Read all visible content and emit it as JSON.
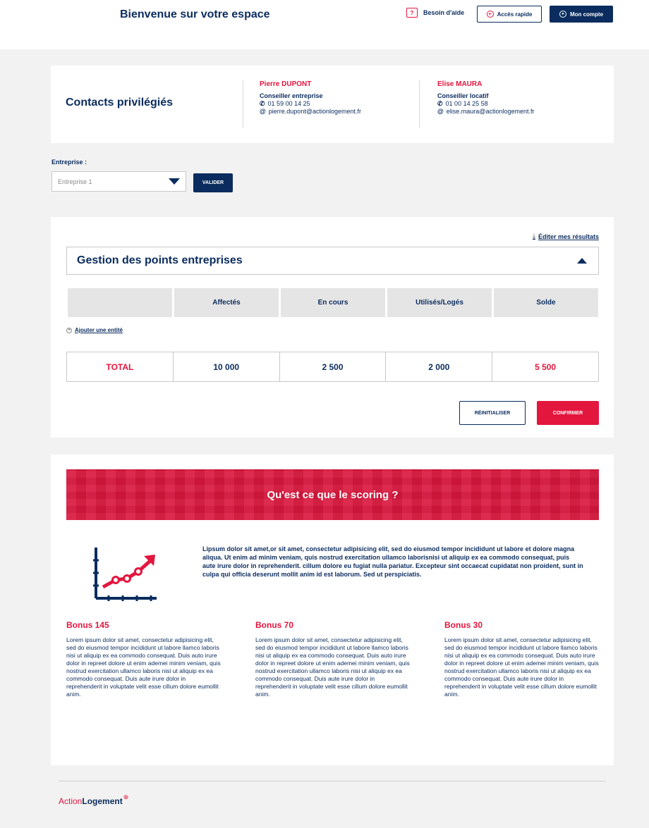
{
  "header": {
    "welcome": "Bienvenue sur votre espace",
    "help_icon": "?",
    "help_label": "Besoin d'aide",
    "quick_access_label": "Accès rapide",
    "account_label": "Mon compte"
  },
  "contacts": {
    "title": "Contacts privilégiés",
    "people": [
      {
        "name": "Pierre DUPONT",
        "role": "Conseiller entreprise",
        "phone": "01 59 00 14 25",
        "email": "pierre.dupont@actionlogement.fr"
      },
      {
        "name": "Elise MAURA",
        "role": "Conseiller locatif",
        "phone": "01 00 14 25 58",
        "email": "elise.maura@actionlogement.fr"
      }
    ]
  },
  "entreprise": {
    "label": "Entreprise :",
    "selected": "Entreprise 1",
    "validate_label": "VALIDER"
  },
  "gestion": {
    "edit_results_label": "Éditer mes résultats",
    "title": "Gestion des points entreprises",
    "columns": [
      "",
      "Affectés",
      "En cours",
      "Utilisés/Logés",
      "Solde"
    ],
    "add_entity_label": "Ajouter une entité",
    "total": {
      "label": "TOTAL",
      "affectes": "10 000",
      "en_cours": "2 500",
      "utilises": "2 000",
      "solde": "5 500"
    },
    "reset_label": "RÉINITIALISER",
    "confirm_label": "CONFIRMER"
  },
  "scoring": {
    "banner_title": "Qu'est ce que le scoring ?",
    "intro": "Lipsum dolor sit amet,or sit amet, consectetur adipisicing elit, sed do eiusmod tempor incididunt ut labore et dolore magna aliqua. Ut enim ad minim veniam, quis nostrud exercitation ullamco laborisnisi ut aliquip ex ea commodo consequat, puis aute irure dolor in reprehenderit. cillum dolore eu fugiat nulla pariatur. Excepteur sint occaecat cupidatat non proident, sunt in culpa qui officia deserunt mollit anim id est laborum. Sed ut perspiciatis.",
    "bonuses": [
      {
        "title": "Bonus 145",
        "text": "Lorem ipsum dolor sit amet, consectetur adipisicing elit, sed do eiusmod tempor incididunt ut labore llamco laboris nisi ut aliquip ex ea commodo consequat. Duis auto irure dolor in repreet dolore ut enim ademei minim veniam, quis nostrud exercitation ullamco laboris nisi ut aliquip ex ea commodo consequat. Duis aute irure dolor in reprehenderit in voluptate velit esse cillum dolore eumollit anim."
      },
      {
        "title": "Bonus 70",
        "text": "Lorem ipsum dolor sit amet, consectetur adipisicing elit, sed do eiusmod tempor incididunt ut labore llamco laboris nisi ut aliquip ex ea commodo consequat. Duis auto irure dolor in repreet dolore ut enim ademei minim veniam, quis nostrud exercitation ullamco laboris nisi ut aliquip ex ea commodo consequat. Duis aute irure dolor in reprehenderit in voluptate velit esse cillum dolore eumollit anim."
      },
      {
        "title": "Bonus 30",
        "text": "Lorem ipsum dolor sit amet, consectetur adipisicing elit, sed do eiusmod tempor incididunt ut labore llamco laboris nisi ut aliquip ex ea commodo consequat. Duis auto irure dolor in repreet dolore ut enim ademei minim veniam, quis nostrud exercitation ullamco laboris nisi ut aliquip ex ea commodo consequat. Duis aute irure dolor in reprehenderit in voluptate velit esse cillum dolore eumollit anim."
      }
    ]
  },
  "footer": {
    "logo_part1": "Action",
    "logo_part2": "Logement"
  },
  "icons": {
    "help": "help-icon",
    "quick_access": "plus-circle-icon",
    "account": "user-circle-icon",
    "phone": "phone-icon",
    "email": "at-icon",
    "download": "download-icon",
    "chart": "growth-chart-icon"
  },
  "colors": {
    "navy": "#0a2c5e",
    "red": "#e3163e",
    "background": "#f2f2f2"
  }
}
